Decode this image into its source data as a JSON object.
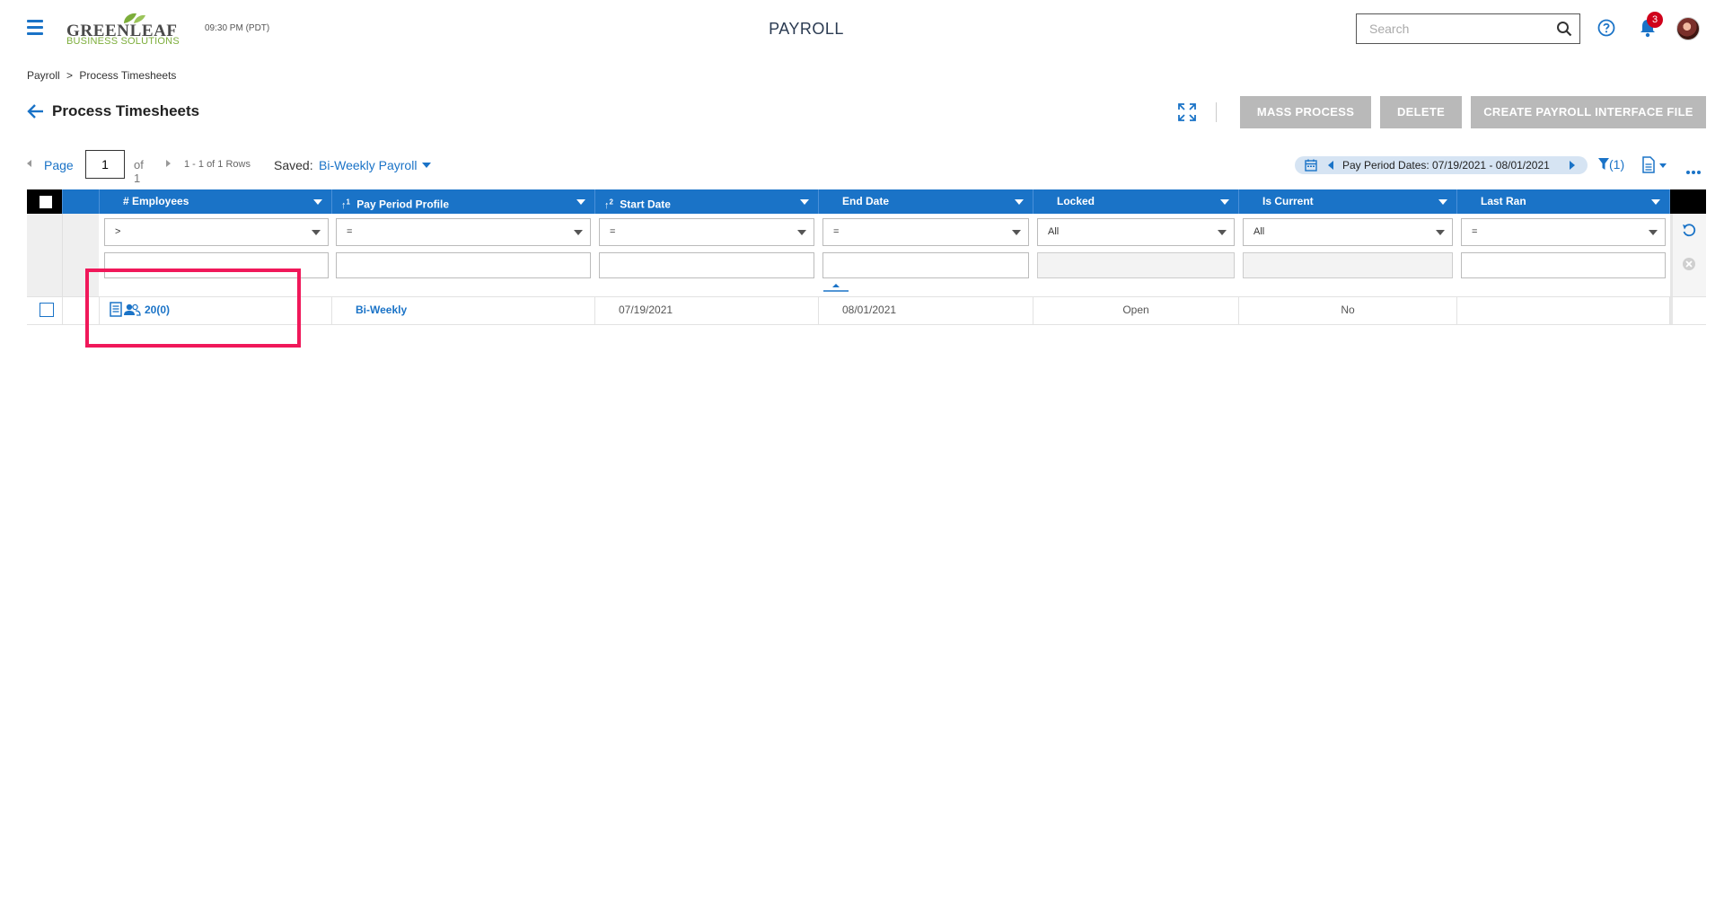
{
  "header": {
    "logo": {
      "main": "GREENLEAF",
      "sub": "BUSINESS SOLUTIONS"
    },
    "time": "09:30 PM (PDT)",
    "app_title": "PAYROLL",
    "search": {
      "placeholder": "Search",
      "value": ""
    },
    "notifications_count": "3",
    "icons": [
      "hamburger-menu-icon",
      "search-icon",
      "help-icon",
      "bell-icon",
      "avatar"
    ]
  },
  "breadcrumb": {
    "items": [
      "Payroll",
      ">",
      "Process Timesheets"
    ]
  },
  "page": {
    "title": "Process Timesheets",
    "buttons": {
      "mass_process": "MASS PROCESS",
      "delete": "DELETE",
      "create_interface": "CREATE PAYROLL INTERFACE FILE"
    }
  },
  "pager": {
    "page_label": "Page",
    "page_value": "1",
    "of_label": "of 1",
    "rows_label": "1 - 1 of 1 Rows",
    "saved_label": "Saved:",
    "saved_value": "Bi-Weekly Payroll"
  },
  "toolbar": {
    "pay_period_text": "Pay Period Dates: 07/19/2021 - 08/01/2021",
    "filter_count": "(1)"
  },
  "grid": {
    "columns": [
      {
        "label": "# Employees",
        "sort": ""
      },
      {
        "label": "Pay Period Profile",
        "sort": "1"
      },
      {
        "label": "Start Date",
        "sort": "2"
      },
      {
        "label": "End Date",
        "sort": ""
      },
      {
        "label": "Locked",
        "sort": ""
      },
      {
        "label": "Is Current",
        "sort": ""
      },
      {
        "label": "Last Ran",
        "sort": ""
      }
    ],
    "filters": [
      {
        "operator": ">",
        "value": "",
        "disabled": false
      },
      {
        "operator": "=",
        "value": "",
        "disabled": false
      },
      {
        "operator": "=",
        "value": "",
        "disabled": false
      },
      {
        "operator": "=",
        "value": "",
        "disabled": false
      },
      {
        "operator": "All",
        "value": "",
        "disabled": true
      },
      {
        "operator": "All",
        "value": "",
        "disabled": true
      },
      {
        "operator": "=",
        "value": "",
        "disabled": false
      }
    ],
    "rows": [
      {
        "employees": "20(0)",
        "pay_period_profile": "Bi-Weekly",
        "start_date": "07/19/2021",
        "end_date": "08/01/2021",
        "locked": "Open",
        "is_current": "No",
        "last_ran": ""
      }
    ]
  },
  "colors": {
    "accent": "#1a73c7",
    "header_bg": "#1a73c7",
    "button_disabled": "#b9b9b9",
    "highlight": "#f0185a",
    "logo_green": "#7cad3a"
  }
}
